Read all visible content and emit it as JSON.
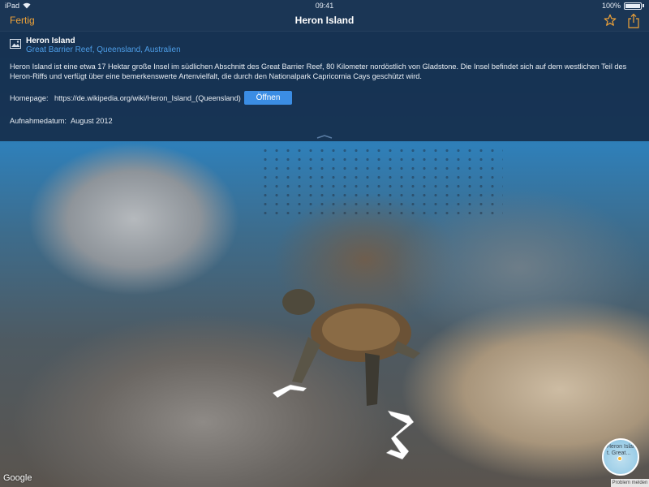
{
  "status_bar": {
    "device": "iPad",
    "time": "09:41",
    "battery": "100%"
  },
  "nav": {
    "done_label": "Fertig",
    "title": "Heron Island",
    "star_icon": "star-icon",
    "share_icon": "share-icon"
  },
  "place": {
    "name": "Heron Island",
    "location": "Great Barrier Reef, Queensland, Australien",
    "description": "Heron Island ist eine etwa 17 Hektar große Insel im südlichen Abschnitt des Great Barrier Reef, 80 Kilometer nordöstlich von Gladstone. Die Insel befindet sich auf dem westlichen Teil des Heron-Riffs und verfügt über eine bemerkenswerte Artenvielfalt, die durch den Nationalpark Capricornia Cays geschützt wird.",
    "homepage_label": "Homepage:",
    "homepage_url": "https://de.wikipedia.org/wiki/Heron_Island_(Queensland)",
    "open_button": "Öffnen",
    "date_label": "Aufnahmedatum:",
    "date_value": "August 2012"
  },
  "map": {
    "logo": "Google",
    "minimap_label": "Heron Island t. Great...",
    "report_label": "Problem melden"
  },
  "colors": {
    "accent_orange": "#f0a338",
    "link_blue": "#4d9ee8",
    "button_blue": "#3b8de4",
    "panel_bg": "#162e4c"
  }
}
